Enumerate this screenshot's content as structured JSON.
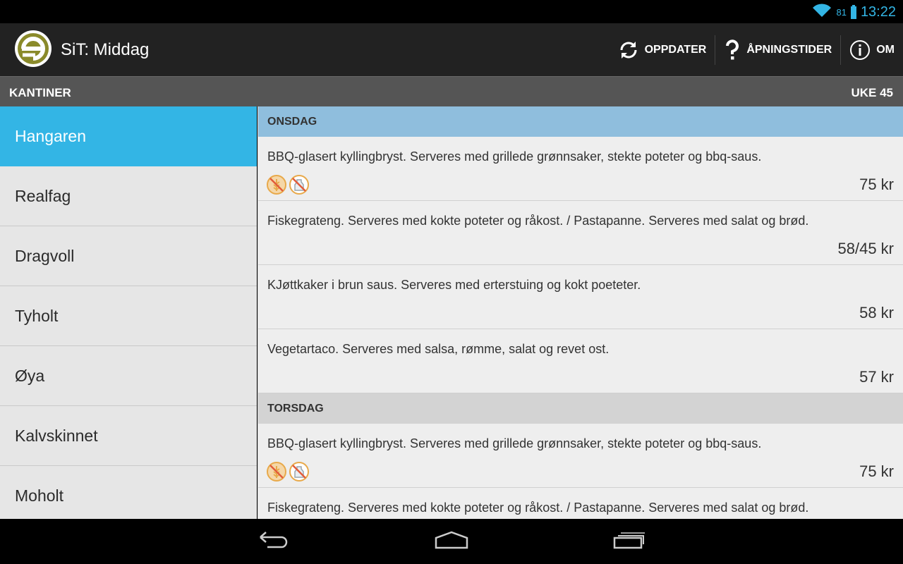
{
  "status_bar": {
    "time": "13:22",
    "battery_level": "81",
    "icons": [
      "wifi-icon",
      "battery-icon"
    ]
  },
  "action_bar": {
    "title": "SiT: Middag",
    "logo_icon": "sit-logo-icon",
    "actions": [
      {
        "label": "OPPDATER",
        "icon": "refresh-icon"
      },
      {
        "label": "ÅPNINGSTIDER",
        "icon": "question-icon"
      },
      {
        "label": "OM",
        "icon": "info-icon"
      }
    ]
  },
  "subheader": {
    "left": "KANTINER",
    "right": "UKE 45"
  },
  "sidebar": {
    "items": [
      {
        "label": "Hangaren",
        "active": true
      },
      {
        "label": "Realfag"
      },
      {
        "label": "Dragvoll"
      },
      {
        "label": "Tyholt"
      },
      {
        "label": "Øya"
      },
      {
        "label": "Kalvskinnet"
      },
      {
        "label": "Moholt"
      }
    ]
  },
  "menu": {
    "days": [
      {
        "name": "ONSDAG",
        "meals": [
          {
            "description": "BBQ-glasert kyllingbryst. Serveres med grillede grønnsaker, stekte poteter og bbq-saus.",
            "price": "75 kr",
            "icons": [
              "gluten-free-icon",
              "lactose-free-icon"
            ]
          },
          {
            "description": "Fiskegrateng. Serveres med kokte poteter og råkost. / Pastapanne. Serveres med salat og brød.",
            "price": "58/45 kr"
          },
          {
            "description": "KJøttkaker i brun saus. Serveres med erterstuing og kokt poeteter.",
            "price": "58 kr"
          },
          {
            "description": "Vegetartaco. Serveres med salsa, rømme, salat og revet ost.",
            "price": "57 kr"
          }
        ]
      },
      {
        "name": "TORSDAG",
        "meals": [
          {
            "description": "BBQ-glasert kyllingbryst. Serveres med grillede grønnsaker, stekte poteter og bbq-saus.",
            "price": "75 kr",
            "icons": [
              "gluten-free-icon",
              "lactose-free-icon"
            ]
          },
          {
            "description": "Fiskegrateng. Serveres med kokte poteter og råkost. / Pastapanne. Serveres med salat og brød."
          }
        ]
      }
    ]
  },
  "nav_bar": {
    "icons": [
      "back-icon",
      "home-icon",
      "recent-apps-icon"
    ]
  },
  "colors": {
    "accent": "#33b5e5",
    "action_bar": "#222222",
    "subheader": "#555555",
    "current_day_header": "#8fbedd",
    "other_day_header": "#d3d3d3",
    "gluten_free_icon": "#e8a94a"
  }
}
